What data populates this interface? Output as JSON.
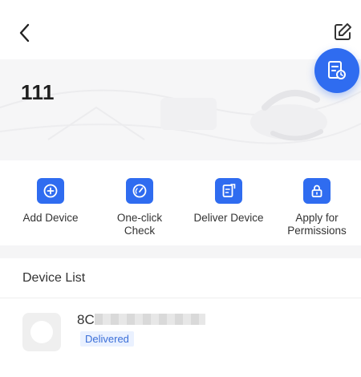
{
  "page": {
    "title": "111"
  },
  "actions": [
    {
      "label": "Add Device",
      "icon": "add-circle-icon"
    },
    {
      "label": "One-click Check",
      "icon": "check-gauge-icon"
    },
    {
      "label": "Deliver Device",
      "icon": "deliver-doc-icon"
    },
    {
      "label": "Apply for Permissions",
      "icon": "lock-icon"
    }
  ],
  "device_list": {
    "header": "Device List",
    "items": [
      {
        "name_visible_prefix": "8C",
        "status": "Delivered"
      }
    ]
  },
  "colors": {
    "accent": "#2f6cf0",
    "badge_bg": "#eaf1ff",
    "badge_text": "#3b6fd8"
  }
}
